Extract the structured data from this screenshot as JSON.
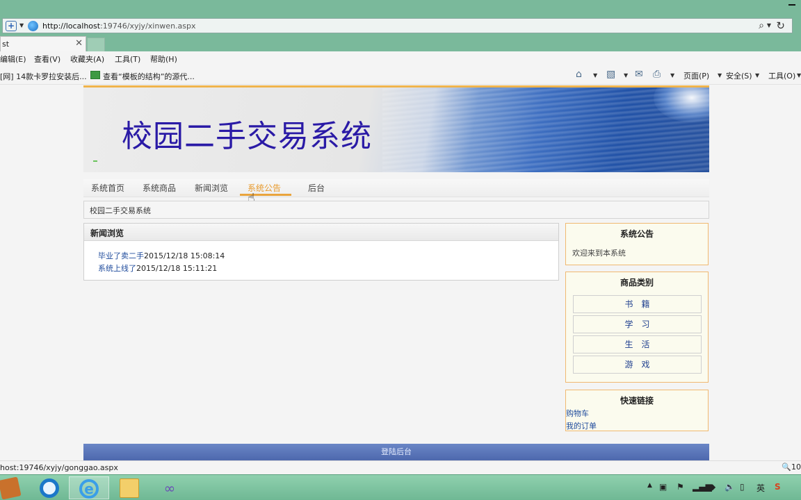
{
  "browser": {
    "url_host": "http://localhost",
    "url_path": ":19746/xyjy/xinwen.aspx",
    "tab_title": "st",
    "menu": [
      "编辑(E)",
      "查看(V)",
      "收藏夹(A)",
      "工具(T)",
      "帮助(H)"
    ],
    "favorites": [
      "[网] 14款卡罗拉安装后...",
      "查看“模板的结构”的源代..."
    ],
    "toolbar": [
      "页面(P)",
      "安全(S)",
      "工具(O)"
    ],
    "status_url": "host:19746/xyjy/gonggao.aspx",
    "zoom": "10"
  },
  "site": {
    "title": "校园二手交易系统",
    "nav": [
      "系统首页",
      "系统商品",
      "新闻浏览",
      "系统公告",
      "后台"
    ],
    "active_nav": "系统公告",
    "breadcrumb": "校园二手交易系统",
    "news": {
      "heading": "新闻浏览",
      "items": [
        {
          "title": "毕业了卖二手",
          "date": "2015/12/18 15:08:14"
        },
        {
          "title": "系统上线了",
          "date": "2015/12/18 15:11:21"
        }
      ]
    },
    "notice": {
      "heading": "系统公告",
      "message": "欢迎来到本系统"
    },
    "categories": {
      "heading": "商品类别",
      "items": [
        "书籍",
        "学习",
        "生活",
        "游戏"
      ]
    },
    "quick_links": {
      "heading": "快速链接",
      "items": [
        "购物车",
        "我的订单"
      ]
    },
    "footer": "登陆后台"
  },
  "tray": [
    "英"
  ],
  "colors": {
    "accent": "#e89b2e",
    "title_blue": "#2a1aa6",
    "footer": "#5a75b8"
  }
}
